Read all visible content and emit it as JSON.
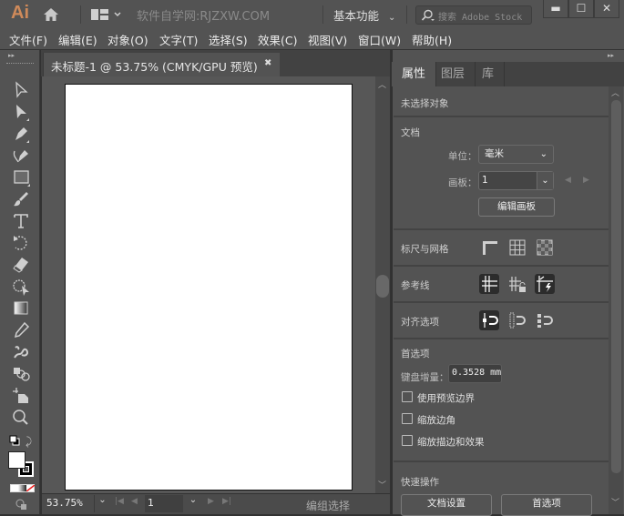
{
  "titlebar": {
    "app_logo": "Ai",
    "home_icon": "home-icon",
    "layout_icon": "arrange-documents-icon",
    "site_text": "软件自学网:RJZXW.COM",
    "workspace": "基本功能",
    "search_placeholder": "搜索 Adobe Stock",
    "window_controls": [
      "minimize",
      "maximize",
      "close"
    ]
  },
  "menu": [
    {
      "label": "文件(F)"
    },
    {
      "label": "编辑(E)"
    },
    {
      "label": "对象(O)"
    },
    {
      "label": "文字(T)"
    },
    {
      "label": "选择(S)"
    },
    {
      "label": "效果(C)"
    },
    {
      "label": "视图(V)"
    },
    {
      "label": "窗口(W)"
    },
    {
      "label": "帮助(H)"
    }
  ],
  "document": {
    "tab_title": "未标题-1 @ 53.75% (CMYK/GPU 预览)",
    "close_glyph": "✖"
  },
  "toolbar": {
    "tools": [
      "selection-tool",
      "direct-selection-tool",
      "pen-tool",
      "curvature-tool",
      "rectangle-tool",
      "paintbrush-tool",
      "type-tool",
      "rotate-tool",
      "eraser-tool",
      "shape-builder-tool",
      "gradient-tool",
      "eyedropper-tool",
      "puppet-warp-tool",
      "blend-tool",
      "artboard-tool",
      "zoom-tool"
    ],
    "fill_color": "#ffffff",
    "stroke_color": "#000000"
  },
  "statusbar": {
    "zoom": "53.75%",
    "artboard_number": "1",
    "status_text": "编组选择"
  },
  "panel": {
    "tabs": [
      {
        "label": "属性",
        "active": true
      },
      {
        "label": "图层",
        "active": false
      },
      {
        "label": "库",
        "active": false
      }
    ],
    "no_selection": "未选择对象",
    "document_section": "文档",
    "units_label": "单位：",
    "units_value": "毫米",
    "artboard_label": "画板：",
    "artboard_value": "1",
    "edit_artboards": "编辑画板",
    "rulers_grids": "标尺与网格",
    "guides": "参考线",
    "snap_options": "对齐选项",
    "preferences": "首选项",
    "keyboard_increment_label": "键盘增量：",
    "keyboard_increment_value": "0.3528 mm",
    "checkboxes": [
      {
        "label": "使用预览边界",
        "checked": false
      },
      {
        "label": "缩放边角",
        "checked": false
      },
      {
        "label": "缩放描边和效果",
        "checked": false
      }
    ],
    "quick_actions": "快速操作",
    "doc_setup_button": "文档设置",
    "prefs_button": "首选项"
  }
}
